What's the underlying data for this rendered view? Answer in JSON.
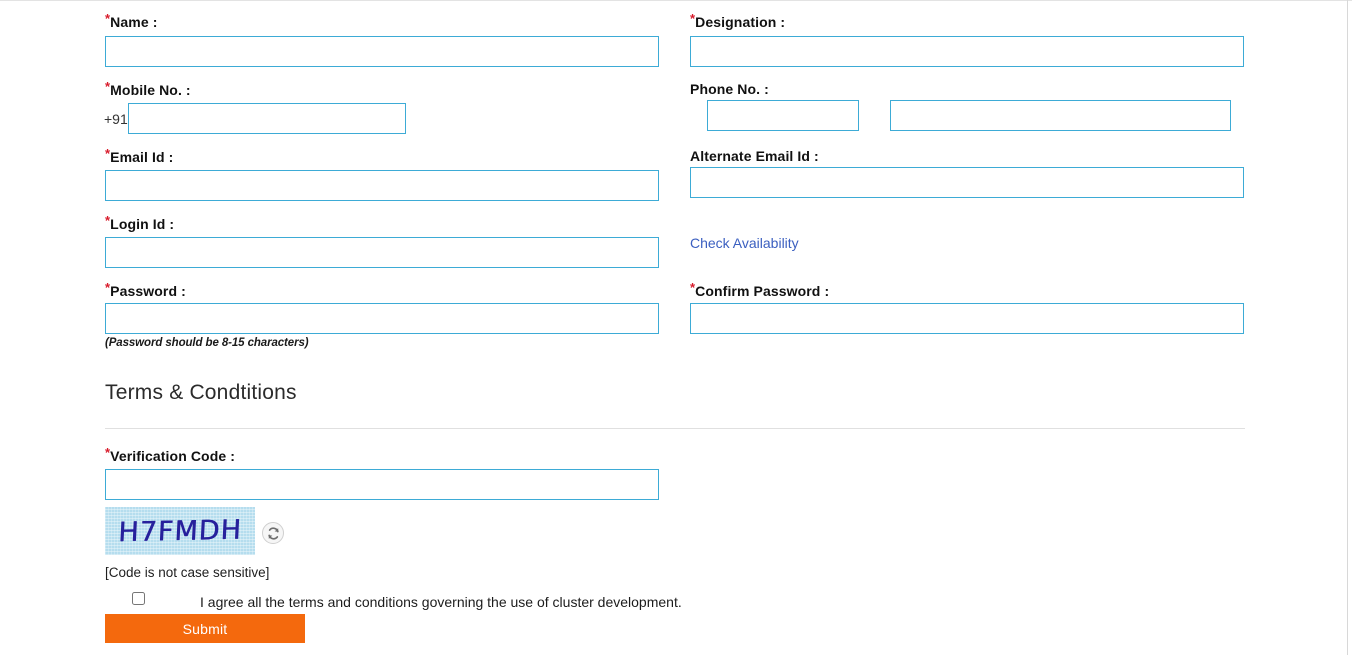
{
  "form": {
    "required_marker": "*",
    "fields": {
      "name": {
        "label": "Name :",
        "required": true,
        "value": "",
        "placeholder": ""
      },
      "designation": {
        "label": "Designation :",
        "required": true,
        "value": "",
        "placeholder": ""
      },
      "mobile": {
        "label": "Mobile No. :",
        "required": true,
        "prefix": "+91",
        "value": "",
        "placeholder": ""
      },
      "phone": {
        "label": "Phone No. :",
        "required": false,
        "std_value": "",
        "number_value": "",
        "placeholder": ""
      },
      "email": {
        "label": "Email Id :",
        "required": true,
        "value": "",
        "placeholder": ""
      },
      "alternate_email": {
        "label": "Alternate Email Id :",
        "required": false,
        "value": "",
        "placeholder": ""
      },
      "login_id": {
        "label": "Login Id :",
        "required": true,
        "value": "",
        "placeholder": ""
      },
      "password": {
        "label": "Password :",
        "required": true,
        "value": "",
        "hint": "(Password should be 8-15 characters)"
      },
      "confirm_password": {
        "label": "Confirm Password :",
        "required": true,
        "value": ""
      },
      "verification_code": {
        "label": "Verification Code :",
        "required": true,
        "value": "",
        "placeholder": ""
      }
    },
    "check_availability_link": "Check Availability",
    "terms_heading": "Terms & Condtitions",
    "captcha": {
      "code_text": "H7FMDH",
      "case_note": "[Code is not case sensitive]",
      "refresh_title": "Refresh code",
      "background_color": "#b5ddee",
      "text_color": "#27209c"
    },
    "agreement": {
      "checked": false,
      "text": "I agree all the terms and conditions governing the use of cluster development."
    },
    "submit_label": "Submit"
  },
  "colors": {
    "input_border": "#3dabd6",
    "required_star": "#d81b2b",
    "link": "#3b5fc0",
    "submit_background": "#f4690d",
    "submit_text": "#ffffff",
    "divider": "#e0e0e0"
  }
}
